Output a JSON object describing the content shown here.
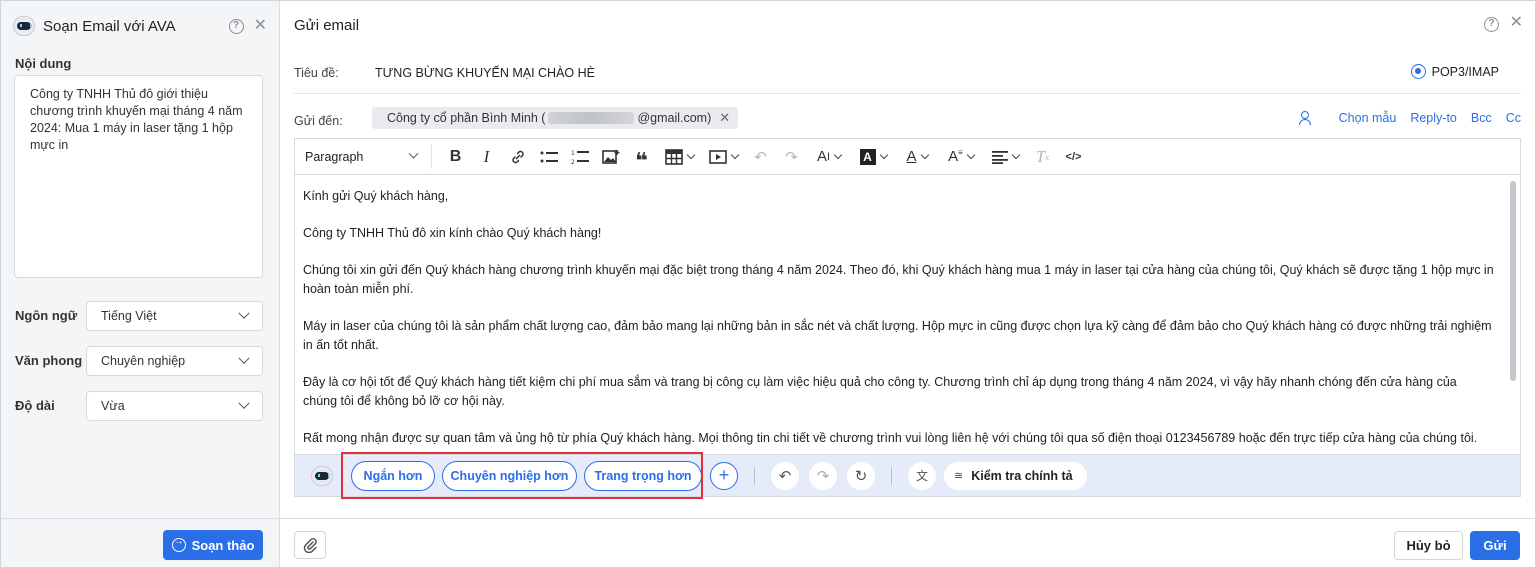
{
  "ava_panel": {
    "title": "Soạn Email với AVA",
    "content_label": "Nội dung",
    "content_text": "Công ty TNHH Thủ đô giới thiệu chương trình khuyến mại tháng 4 năm 2024: Mua 1 máy in laser tặng 1 hộp mực in",
    "language_label": "Ngôn ngữ",
    "language_value": "Tiếng Việt",
    "style_label": "Văn phong",
    "style_value": "Chuyên nghiệp",
    "length_label": "Độ dài",
    "length_value": "Vừa",
    "compose_button": "Soạn thảo"
  },
  "email": {
    "title": "Gửi email",
    "subject_label": "Tiêu đề:",
    "subject_value": "TƯNG BỪNG KHUYẾN MẠI CHÀO HÈ",
    "protocol_option": "POP3/IMAP",
    "to_label": "Gửi đến:",
    "recipient_name": "Công ty cổ phần Bình Minh (",
    "recipient_email_suffix": "@gmail.com)",
    "template_link": "Chọn mẫu",
    "replyto_link": "Reply-to",
    "bcc_link": "Bcc",
    "cc_link": "Cc"
  },
  "toolbar": {
    "paragraph_select": "Paragraph",
    "icons": [
      "bold-icon",
      "italic-icon",
      "link-icon",
      "bullet-list-icon",
      "numbered-list-icon",
      "image-icon",
      "quote-icon",
      "table-icon",
      "media-icon",
      "undo-icon",
      "redo-icon",
      "font-size-icon",
      "highlight-icon",
      "text-color-icon",
      "font-style-icon",
      "align-icon",
      "clear-format-icon",
      "source-code-icon"
    ]
  },
  "body": {
    "paragraphs": [
      "Kính gửi Quý khách hàng,",
      "Công ty TNHH Thủ đô xin kính chào Quý khách hàng!",
      "Chúng tôi xin gửi đến Quý khách hàng chương trình khuyến mại đặc biệt trong tháng 4 năm 2024. Theo đó, khi Quý khách hàng mua 1 máy in laser tại cửa hàng của chúng tôi, Quý khách sẽ được tặng 1 hộp mực in hoàn toàn miễn phí.",
      "Máy in laser của chúng tôi là sản phẩm chất lượng cao, đảm bảo mang lại những bản in sắc nét và chất lượng. Hộp mực in cũng được chọn lựa kỹ càng để đảm bảo cho Quý khách hàng có được những trải nghiệm in ấn tốt nhất.",
      "Đây là cơ hội tốt để Quý khách hàng tiết kiệm chi phí mua sắm và trang bị công cụ làm việc hiệu quả cho công ty. Chương trình chỉ áp dụng trong tháng 4 năm 2024, vì vậy hãy nhanh chóng đến cửa hàng của chúng tôi để không bỏ lỡ cơ hội này.",
      "Rất mong nhận được sự quan tâm và ủng hộ từ phía Quý khách hàng. Mọi thông tin chi tiết về chương trình vui lòng liên hệ với chúng tôi qua số điện thoại 0123456789 hoặc đến trực tiếp cửa hàng của chúng tôi."
    ]
  },
  "ava_bar": {
    "shorter": "Ngắn hơn",
    "more_professional": "Chuyên nghiệp hơn",
    "more_formal": "Trang trọng hơn",
    "spellcheck": "Kiểm tra chính tả"
  },
  "footer": {
    "cancel": "Hủy bỏ",
    "send": "Gửi"
  },
  "colors": {
    "accent": "#2a6ee8",
    "highlight_box": "#e5303a",
    "ava_bar_bg": "#e6ebfa"
  }
}
